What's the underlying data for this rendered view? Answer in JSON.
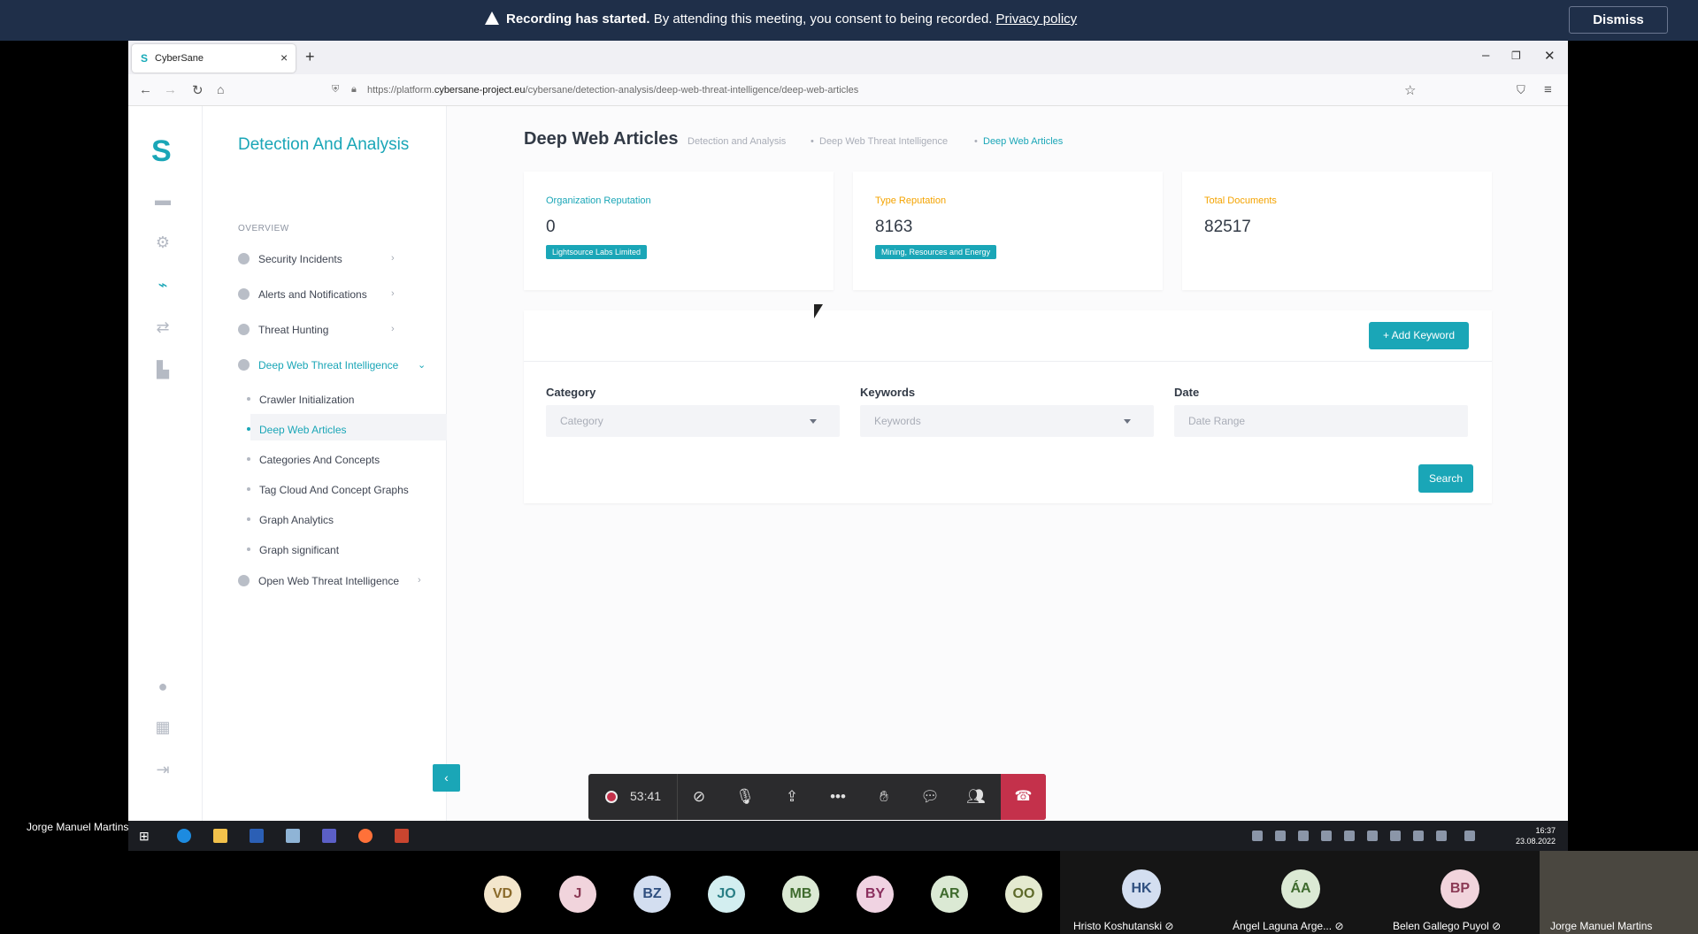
{
  "banner": {
    "title": "Recording has started.",
    "message": "By attending this meeting, you consent to being recorded.",
    "link": "Privacy policy",
    "dismiss": "Dismiss"
  },
  "browser": {
    "tab_title": "CyberSane",
    "url_prefix": "https://platform.",
    "url_domain": "cybersane-project.eu",
    "url_path": "/cybersane/detection-analysis/deep-web-threat-intelligence/deep-web-articles"
  },
  "sidebar": {
    "section_title": "Detection And Analysis",
    "overview_label": "OVERVIEW",
    "items": [
      {
        "label": "Security Incidents"
      },
      {
        "label": "Alerts and Notifications"
      },
      {
        "label": "Threat Hunting"
      },
      {
        "label": "Deep Web Threat Intelligence"
      },
      {
        "label": "Open Web Threat Intelligence"
      }
    ],
    "subitems": [
      {
        "label": "Crawler Initialization"
      },
      {
        "label": "Deep Web Articles"
      },
      {
        "label": "Categories And Concepts"
      },
      {
        "label": "Tag Cloud And Concept Graphs"
      },
      {
        "label": "Graph Analytics"
      },
      {
        "label": "Graph significant"
      }
    ]
  },
  "main": {
    "title": "Deep Web Articles",
    "breadcrumb": [
      "Detection and Analysis",
      "Deep Web Threat Intelligence",
      "Deep Web Articles"
    ],
    "cards": [
      {
        "label": "Organization Reputation",
        "value": "0",
        "tag": "Lightsource Labs Limited",
        "color": "#1aa6b7"
      },
      {
        "label": "Type Reputation",
        "value": "8163",
        "tag": "Mining, Resources and Energy",
        "color": "#f4a300"
      },
      {
        "label": "Total Documents",
        "value": "82517",
        "color": "#f4a300"
      }
    ],
    "add_keyword": "Add Keyword",
    "filters": {
      "category_label": "Category",
      "category_placeholder": "Category",
      "keywords_label": "Keywords",
      "keywords_placeholder": "Keywords",
      "date_label": "Date",
      "date_placeholder": "Date Range"
    },
    "search": "Search"
  },
  "call": {
    "timer": "53:41",
    "presenter": "Jorge Manuel Martins",
    "participants": [
      {
        "initials": "VD",
        "bg": "#f3e6cc",
        "fg": "#8a6a2a"
      },
      {
        "initials": "J",
        "bg": "#f1d4dc",
        "fg": "#8b3a55"
      },
      {
        "initials": "BZ",
        "bg": "#d3def0",
        "fg": "#2f4f7f"
      },
      {
        "initials": "JO",
        "bg": "#d3eef0",
        "fg": "#2a7f86"
      },
      {
        "initials": "MB",
        "bg": "#dbe9d4",
        "fg": "#3f6b2e"
      },
      {
        "initials": "BY",
        "bg": "#f0d3e2",
        "fg": "#8b2f5e"
      },
      {
        "initials": "AR",
        "bg": "#dbe9d4",
        "fg": "#3f6b2e"
      },
      {
        "initials": "OO",
        "bg": "#e4ead0",
        "fg": "#5e6a2a"
      }
    ],
    "tiles": [
      {
        "initials": "HK",
        "name": "Hristo Koshutanski",
        "bg": "#d3def0",
        "fg": "#2f4f7f"
      },
      {
        "initials": "ÁA",
        "name": "Ángel Laguna Arge...",
        "bg": "#dbe9d4",
        "fg": "#3f6b2e"
      },
      {
        "initials": "BP",
        "name": "Belen Gallego Puyol",
        "bg": "#f1d4dc",
        "fg": "#8b3a55"
      }
    ],
    "self_name": "Jorge Manuel Martins"
  },
  "taskbar": {
    "time": "16:37",
    "date": "23.08.2022"
  }
}
